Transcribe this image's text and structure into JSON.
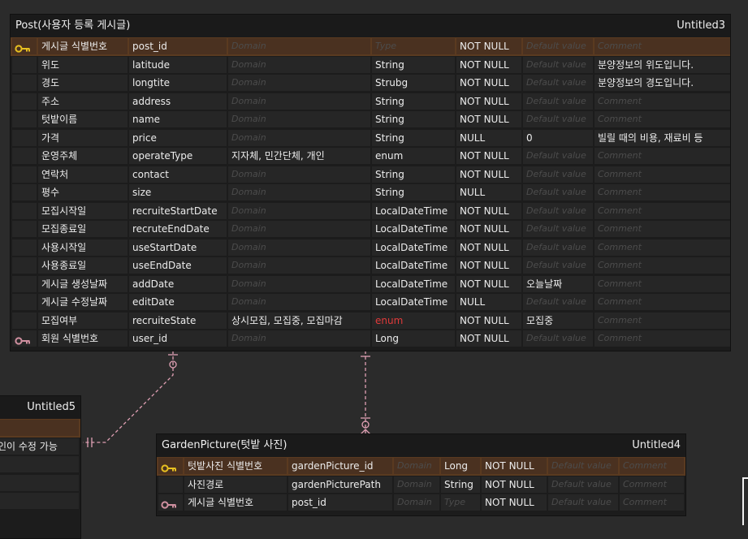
{
  "colors": {
    "background": "#2b2b2b",
    "pk_row": "#5a3a20",
    "connector": "#e0a0b4",
    "red_type": "#e03a3a"
  },
  "post": {
    "name": "Post(사용자 등록 게시글)",
    "tag": "Untitled3",
    "rows": [
      {
        "key": "pk",
        "label": "게시글 식별번호",
        "name": "post_id",
        "domain": "Domain",
        "type": "Type",
        "nullable": "NOT NULL",
        "default": "Default value",
        "comment": "Comment"
      },
      {
        "key": "",
        "label": "위도",
        "name": "latitude",
        "domain": "Domain",
        "type": "String",
        "nullable": "NOT NULL",
        "default": "Default value",
        "comment": "분양정보의 위도입니다."
      },
      {
        "key": "",
        "label": "경도",
        "name": "longtite",
        "domain": "Domain",
        "type": "Strubg",
        "nullable": "NOT NULL",
        "default": "Default value",
        "comment": "분양정보의 경도입니다."
      },
      {
        "key": "",
        "label": "주소",
        "name": "address",
        "domain": "Domain",
        "type": "String",
        "nullable": "NOT NULL",
        "default": "Default value",
        "comment": "Comment"
      },
      {
        "key": "",
        "label": "텃밭이름",
        "name": "name",
        "domain": "Domain",
        "type": "String",
        "nullable": "NOT NULL",
        "default": "Default value",
        "comment": "Comment"
      },
      {
        "key": "",
        "label": "가격",
        "name": "price",
        "domain": "Domain",
        "type": "String",
        "nullable": "NULL",
        "default": "0",
        "comment": "빌릴 때의 비용, 재료비 등"
      },
      {
        "key": "",
        "label": "운영주체",
        "name": "operateType",
        "domain": "지자체, 민간단체, 개인",
        "type": "enum",
        "nullable": "NOT NULL",
        "default": "Default value",
        "comment": "Comment"
      },
      {
        "key": "",
        "label": "연락처",
        "name": "contact",
        "domain": "Domain",
        "type": "String",
        "nullable": "NOT NULL",
        "default": "Default value",
        "comment": "Comment"
      },
      {
        "key": "",
        "label": "평수",
        "name": "size",
        "domain": "Domain",
        "type": "String",
        "nullable": "NULL",
        "default": "Default value",
        "comment": "Comment"
      },
      {
        "key": "",
        "label": "모집시작일",
        "name": "recruiteStartDate",
        "domain": "Domain",
        "type": "LocalDateTime",
        "nullable": "NOT NULL",
        "default": "Default value",
        "comment": "Comment"
      },
      {
        "key": "",
        "label": "모집종료일",
        "name": "recruteEndDate",
        "domain": "Domain",
        "type": "LocalDateTime",
        "nullable": "NOT NULL",
        "default": "Default value",
        "comment": "Comment"
      },
      {
        "key": "",
        "label": "사용시작일",
        "name": "useStartDate",
        "domain": "Domain",
        "type": "LocalDateTime",
        "nullable": "NOT NULL",
        "default": "Default value",
        "comment": "Comment"
      },
      {
        "key": "",
        "label": "사용종료일",
        "name": "useEndDate",
        "domain": "Domain",
        "type": "LocalDateTime",
        "nullable": "NOT NULL",
        "default": "Default value",
        "comment": "Comment"
      },
      {
        "key": "",
        "label": "게시글 생성날짜",
        "name": "addDate",
        "domain": "Domain",
        "type": "LocalDateTime",
        "nullable": "NOT NULL",
        "default": "오늘날짜",
        "comment": "Comment"
      },
      {
        "key": "",
        "label": "게시글 수정날짜",
        "name": "editDate",
        "domain": "Domain",
        "type": "LocalDateTime",
        "nullable": "NULL",
        "default": "Default value",
        "comment": "Comment"
      },
      {
        "key": "",
        "label": "모집여부",
        "name": "recruiteState",
        "domain": "상시모집, 모집중, 모집마감",
        "type": "enum",
        "nullable": "NOT NULL",
        "default": "모집중",
        "comment": "Comment"
      },
      {
        "key": "fk",
        "label": "회원 식별번호",
        "name": "user_id",
        "domain": "Domain",
        "type": "Long",
        "nullable": "NOT NULL",
        "default": "Default value",
        "comment": "Comment"
      }
    ]
  },
  "garden": {
    "name": "GardenPicture(텃밭 사진)",
    "tag": "Untitled4",
    "rows": [
      {
        "key": "pk",
        "label": "텃밭사진 식별번호",
        "name": "gardenPicture_id",
        "domain": "Domain",
        "type": "Long",
        "nullable": "NOT NULL",
        "default": "Default value",
        "comment": "Comment"
      },
      {
        "key": "",
        "label": "사진경로",
        "name": "gardenPicturePath",
        "domain": "Domain",
        "type": "String",
        "nullable": "NOT NULL",
        "default": "Default value",
        "comment": "Comment"
      },
      {
        "key": "fk",
        "label": "게시글 식별번호",
        "name": "post_id",
        "domain": "Domain",
        "type": "Type",
        "nullable": "NOT NULL",
        "default": "Default value",
        "comment": "Comment"
      }
    ]
  },
  "untitled5": {
    "tag": "Untitled5",
    "rows": [
      "",
      "인이 수정 가능",
      "",
      "",
      ""
    ]
  }
}
